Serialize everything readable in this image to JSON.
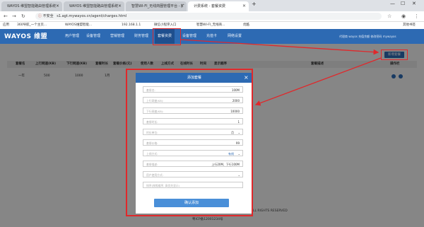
{
  "browser": {
    "tabs": [
      {
        "label": "WAYOS 维盟智能路由管理系统 - ",
        "active": false
      },
      {
        "label": "WAYOS 维盟智能路由管理系统 - ",
        "active": false
      },
      {
        "label": "智慧WI-FI_无线商圈管理平台 - 扩",
        "active": false
      },
      {
        "label": "计费系统 - 套餐资费",
        "active": true
      }
    ],
    "new_tab": "+",
    "window_controls": [
      "—",
      "☐",
      "✕"
    ],
    "security_label": "不安全",
    "url": "s1.agt.mywayos.cn/agent/charges.html",
    "bookmarks": [
      "应用",
      "360导航_一个主页...",
      "WAYOS维盟智能...",
      "192.168.1.1",
      "微信小程序入口",
      "智慧WI-FI_无线商...",
      "优酷",
      "其他书签"
    ]
  },
  "app": {
    "logo": "WAYOS 维盟",
    "nav": [
      "用户管理",
      "设备管理",
      "营销管理",
      "财务管理",
      "套餐资费",
      "设备管理",
      "充值卡",
      "网络设置"
    ],
    "active_nav": "套餐资费",
    "header_right": "代理商  wayos  充值余额  修改密码  mywayos",
    "add_button": "新增套餐"
  },
  "table": {
    "headers": [
      "套餐名",
      "上行网速(KB)",
      "下行网速(KB)",
      "套餐时长",
      "套餐价格(元)",
      "使用人数",
      "上线方式",
      "在线时长",
      "时间",
      "显示顺序",
      "套餐描述",
      "操作栏"
    ],
    "rows": [
      [
        "一年",
        "500",
        "1000",
        "1月",
        "",
        "",
        "",
        "",
        "",
        "",
        "",
        ""
      ]
    ]
  },
  "modal": {
    "title": "添加套餐",
    "close": "×",
    "fields": [
      {
        "label": "套餐名:",
        "value": "100M"
      },
      {
        "label": "上行网速(KB):",
        "value": "2000"
      },
      {
        "label": "下行网速(KB):",
        "value": "10000"
      },
      {
        "label": "套餐时长:",
        "value": "1"
      },
      {
        "label": "时长单位:",
        "value": "月",
        "dropdown": true
      },
      {
        "label": "套餐价格:",
        "value": "99"
      },
      {
        "label": "上线方式:",
        "value": "有线",
        "dropdown": true
      },
      {
        "label": "套餐描述:",
        "value": "上行20M、下行100M"
      },
      {
        "label": "用户使用方式:",
        "value": "",
        "dropdown": true
      },
      {
        "label": "排序(按照顺序, 高优先显示)",
        "value": ""
      }
    ],
    "submit": "确认添加"
  },
  "footer": {
    "copyright": "COPYRIGHT © 2008-2019 深圳维盟科技股份有限公司 ALL RIGHTS RESERVED",
    "icp": "粤ICP备12001234号"
  },
  "colors": {
    "brand": "#2d6ab3",
    "annotation": "#e0282b"
  }
}
